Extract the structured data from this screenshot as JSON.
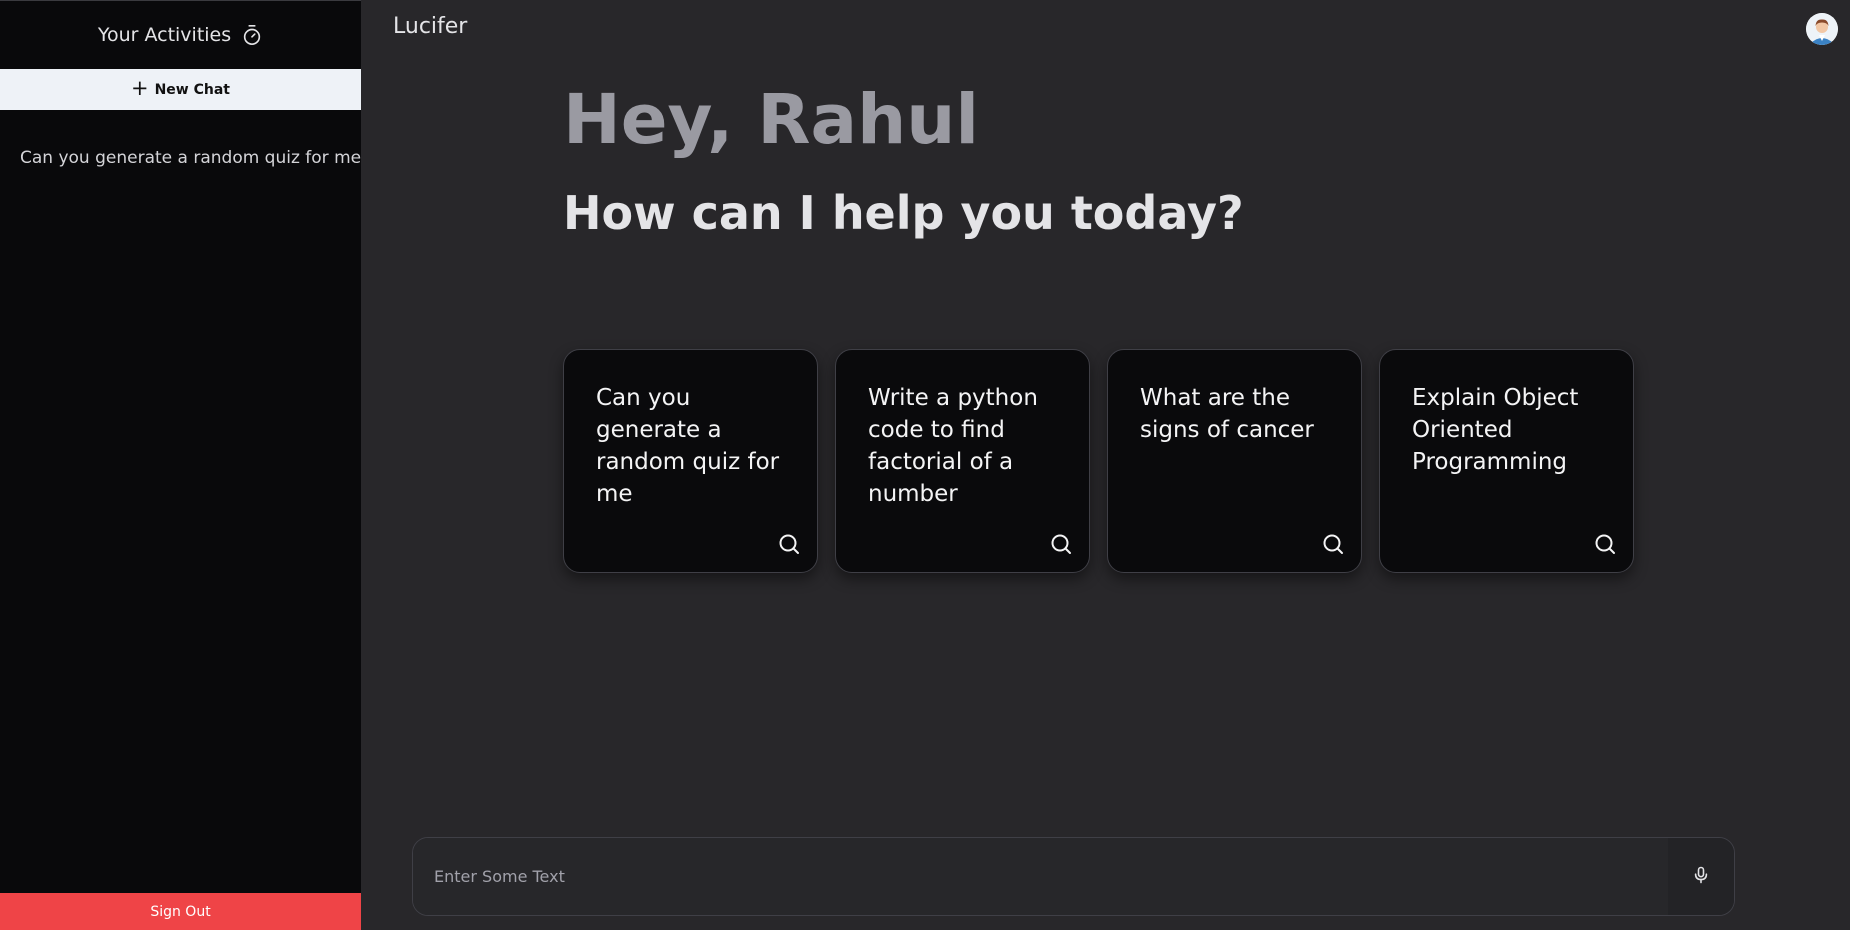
{
  "sidebar": {
    "title": "Your Activities",
    "timer_icon": "timer-icon",
    "new_chat_label": "New Chat",
    "history": [
      "Can you generate a random quiz for me"
    ],
    "sign_out_label": "Sign Out"
  },
  "header": {
    "app_title": "Lucifer",
    "avatar_icon": "user-avatar"
  },
  "greeting": {
    "line1": "Hey, Rahul",
    "line2": "How can I help you today?"
  },
  "cards": [
    {
      "text": "Can you generate a random quiz for me",
      "icon": "search-icon"
    },
    {
      "text": "Write a python code to find factorial of a number",
      "icon": "search-icon"
    },
    {
      "text": "What are the signs of cancer",
      "icon": "search-icon"
    },
    {
      "text": "Explain Object Oriented Programming",
      "icon": "search-icon"
    }
  ],
  "input": {
    "placeholder": "Enter Some Text",
    "value": "",
    "mic_icon": "mic-icon"
  },
  "colors": {
    "sidebar_bg": "#09090b",
    "main_bg": "#28272a",
    "card_bg": "#0a0a0c",
    "sign_out_bg": "#ef4447",
    "new_chat_bg": "#eef2f7"
  }
}
